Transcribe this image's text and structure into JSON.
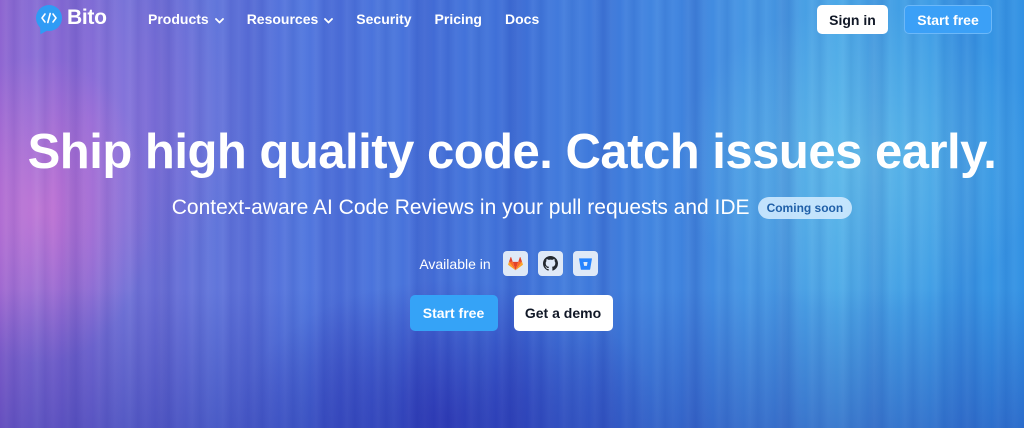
{
  "brand": {
    "name": "Bito",
    "logo_icon": "code-bubble-icon",
    "accent_color": "#2f9bf5"
  },
  "nav": {
    "items": [
      {
        "label": "Products",
        "has_dropdown": true
      },
      {
        "label": "Resources",
        "has_dropdown": true
      },
      {
        "label": "Security",
        "has_dropdown": false
      },
      {
        "label": "Pricing",
        "has_dropdown": false
      },
      {
        "label": "Docs",
        "has_dropdown": false
      }
    ],
    "signin_label": "Sign in",
    "startfree_label": "Start free"
  },
  "hero": {
    "headline": "Ship high quality code. Catch issues early.",
    "subheadline": "Context-aware AI Code Reviews in your pull requests and IDE",
    "badge": "Coming soon",
    "available_label": "Available in",
    "platforms": [
      {
        "icon": "gitlab-icon",
        "color": "#e2432a"
      },
      {
        "icon": "github-icon",
        "color": "#24292f"
      },
      {
        "icon": "bitbucket-icon",
        "color": "#2684ff"
      }
    ],
    "primary_cta": "Start free",
    "secondary_cta": "Get a demo"
  }
}
